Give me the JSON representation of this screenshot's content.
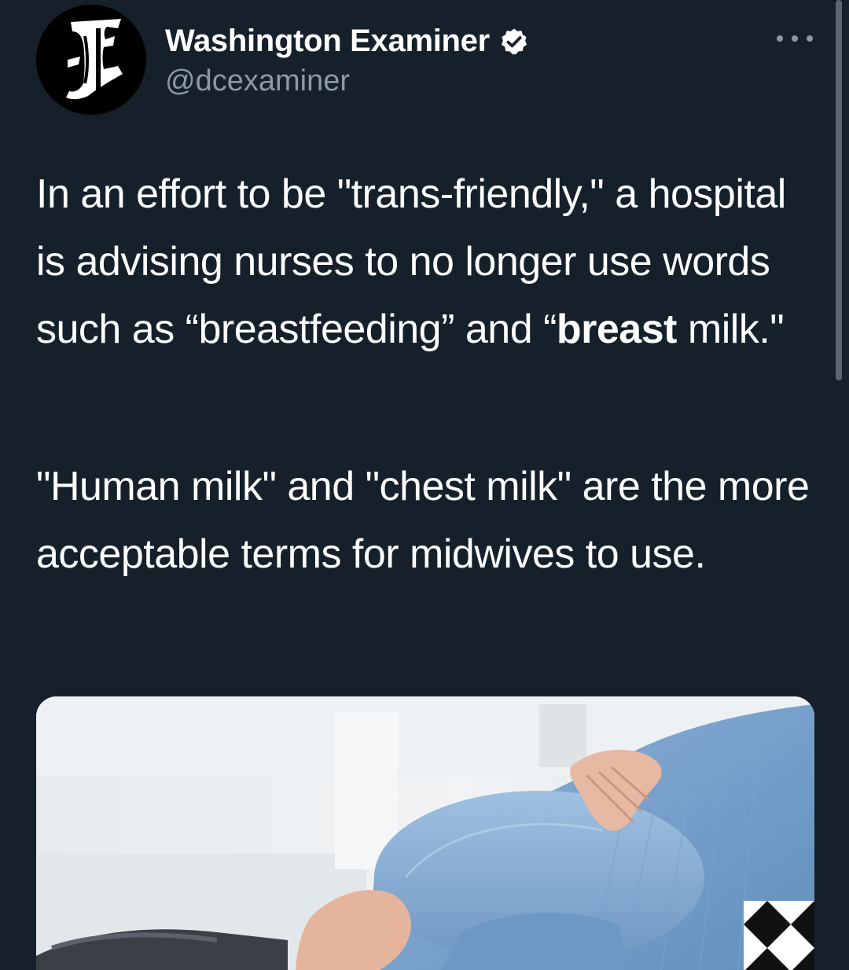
{
  "account": {
    "display_name": "Washington Examiner",
    "handle": "@dcexaminer",
    "verified": true,
    "avatar_icon": "gothic-e-logo-icon"
  },
  "tweet": {
    "paragraph1": {
      "part1": "In an effort to be \"trans-friendly,\" a hospital is advising nurses to no longer use words such as “breastfeeding” and “",
      "bold": "breast",
      "part2": " milk.\""
    },
    "paragraph2": "\"Human milk\" and \"chest milk\" are the more acceptable terms for midwives to use."
  },
  "media": {
    "description_icon": "photo-pregnant-woman"
  },
  "colors": {
    "background": "#15202b",
    "text": "#ffffff",
    "secondary_text": "#8b98a5",
    "verified_badge": "#ffffff"
  }
}
